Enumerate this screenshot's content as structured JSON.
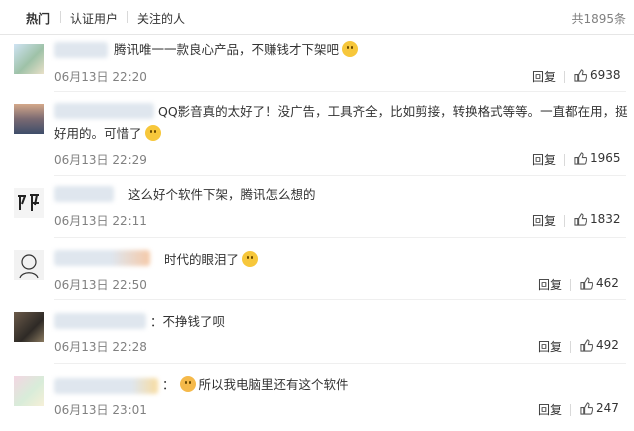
{
  "tabs": [
    {
      "label": "热门"
    },
    {
      "label": "认证用户"
    },
    {
      "label": "关注的人"
    }
  ],
  "total": "共1895条",
  "comments": [
    {
      "text": "腾讯唯一一款良心产品，不赚钱才下架吧",
      "time": "06月13日 22:20",
      "reply": "回复",
      "likes": "6938",
      "emoji": "smile-emoji-icon"
    },
    {
      "text": "QQ影音真的太好了！没广告，工具齐全，比如剪接，转换格式等等。一直都在用，挺",
      "text2": "好用的。可惜了",
      "time": "06月13日 22:29",
      "reply": "回复",
      "likes": "1965",
      "emoji": "crying-emoji-icon"
    },
    {
      "text": "这么好个软件下架，腾讯怎么想的",
      "time": "06月13日 22:11",
      "reply": "回复",
      "likes": "1832"
    },
    {
      "text": "时代的眼泪了",
      "time": "06月13日 22:50",
      "reply": "回复",
      "likes": "462",
      "emoji": "tear-emoji-icon"
    },
    {
      "text": "：不挣钱了呗",
      "time": "06月13日 22:28",
      "reply": "回复",
      "likes": "492"
    },
    {
      "text": "：",
      "text_after": "所以我电脑里还有这个软件",
      "time": "06月13日 23:01",
      "reply": "回复",
      "likes": "247",
      "emoji": "doge-emoji-icon"
    }
  ],
  "colors": {
    "text": "#333333",
    "muted": "#808080",
    "border": "#e6e6e6",
    "emoji": "#f7c73b"
  }
}
